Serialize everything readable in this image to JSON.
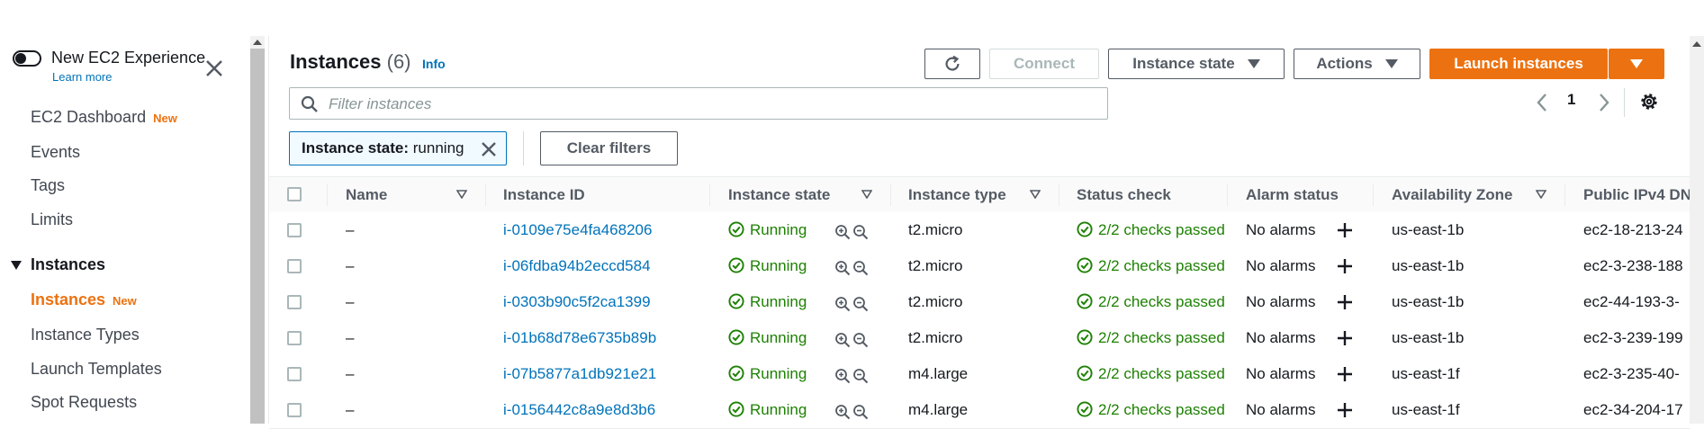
{
  "sidebar": {
    "new_experience_title": "New EC2 Experience",
    "learn_more": "Learn more",
    "items_top": [
      {
        "label": "EC2 Dashboard",
        "badge": "New"
      },
      {
        "label": "Events"
      },
      {
        "label": "Tags"
      },
      {
        "label": "Limits"
      }
    ],
    "section_label": "Instances",
    "section_items": [
      {
        "label": "Instances",
        "badge": "New",
        "active": true
      },
      {
        "label": "Instance Types"
      },
      {
        "label": "Launch Templates"
      },
      {
        "label": "Spot Requests"
      }
    ]
  },
  "header": {
    "title": "Instances",
    "count": "(6)",
    "info": "Info",
    "connect": "Connect",
    "instance_state": "Instance state",
    "actions": "Actions",
    "launch": "Launch instances"
  },
  "search": {
    "placeholder": "Filter instances"
  },
  "pager": {
    "page": "1"
  },
  "filter": {
    "token_key": "Instance state:",
    "token_value": " running",
    "clear": "Clear filters"
  },
  "table": {
    "columns": [
      "Name",
      "Instance ID",
      "Instance state",
      "Instance type",
      "Status check",
      "Alarm status",
      "Availability Zone",
      "Public IPv4 DN"
    ],
    "rows": [
      {
        "name": "–",
        "id": "i-0109e75e4fa468206",
        "state": "Running",
        "type": "t2.micro",
        "status": "2/2 checks passed",
        "alarm": "No alarms",
        "az": "us-east-1b",
        "dns": "ec2-18-213-24"
      },
      {
        "name": "–",
        "id": "i-06fdba94b2eccd584",
        "state": "Running",
        "type": "t2.micro",
        "status": "2/2 checks passed",
        "alarm": "No alarms",
        "az": "us-east-1b",
        "dns": "ec2-3-238-188"
      },
      {
        "name": "–",
        "id": "i-0303b90c5f2ca1399",
        "state": "Running",
        "type": "t2.micro",
        "status": "2/2 checks passed",
        "alarm": "No alarms",
        "az": "us-east-1b",
        "dns": "ec2-44-193-3-"
      },
      {
        "name": "–",
        "id": "i-01b68d78e6735b89b",
        "state": "Running",
        "type": "t2.micro",
        "status": "2/2 checks passed",
        "alarm": "No alarms",
        "az": "us-east-1b",
        "dns": "ec2-3-239-199"
      },
      {
        "name": "–",
        "id": "i-07b5877a1db921e21",
        "state": "Running",
        "type": "m4.large",
        "status": "2/2 checks passed",
        "alarm": "No alarms",
        "az": "us-east-1f",
        "dns": "ec2-3-235-40-"
      },
      {
        "name": "–",
        "id": "i-0156442c8a9e8d3b6",
        "state": "Running",
        "type": "m4.large",
        "status": "2/2 checks passed",
        "alarm": "No alarms",
        "az": "us-east-1f",
        "dns": "ec2-34-204-17"
      }
    ]
  },
  "colors": {
    "accent": "#ec7211",
    "link": "#0073bb",
    "success": "#1d8102"
  }
}
